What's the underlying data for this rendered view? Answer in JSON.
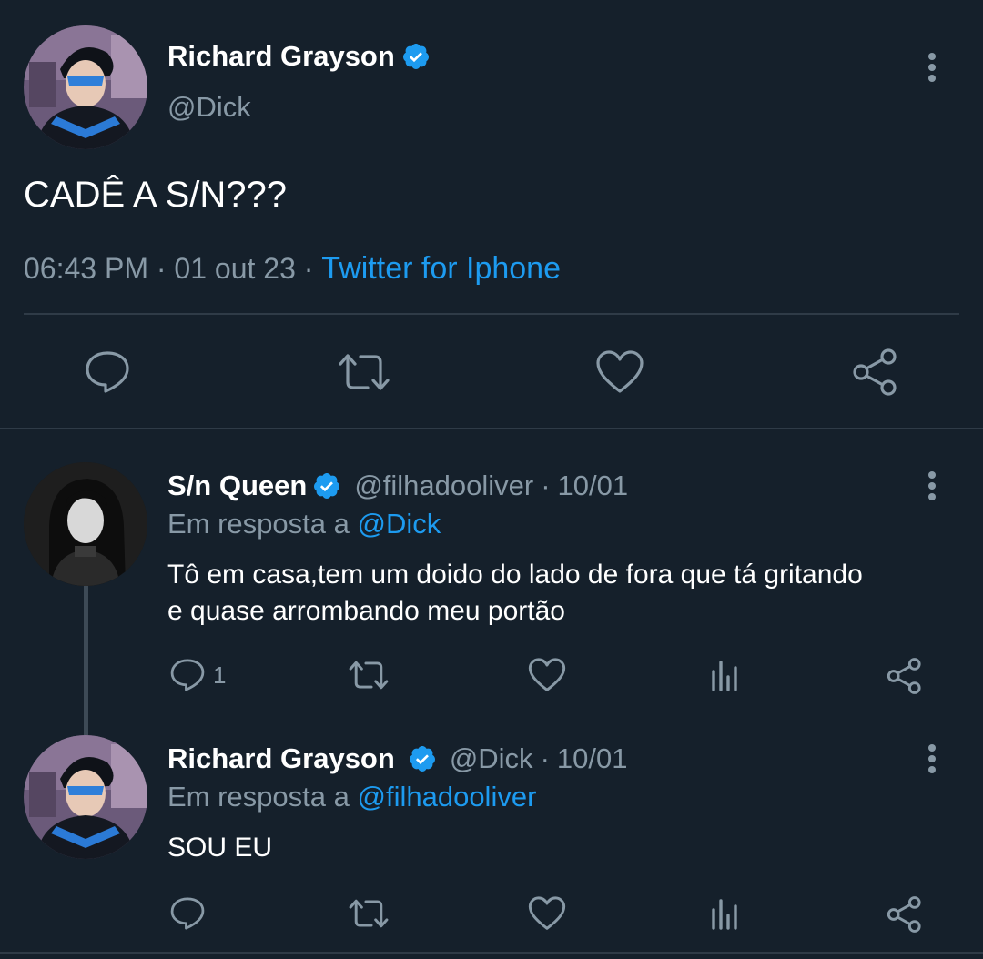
{
  "colors": {
    "background": "#15202b",
    "accent": "#1d9bf0",
    "muted": "#8899a6",
    "divider": "#2f3b47"
  },
  "main_tweet": {
    "author_name": "Richard Grayson",
    "author_handle": "@Dick",
    "text": "CADÊ A S/N???",
    "time": "06:43 PM",
    "sep1": "·",
    "date": "01 out 23",
    "sep2": "·",
    "source": "Twitter for Iphone",
    "actions": [
      "reply-icon",
      "retweet-icon",
      "like-icon",
      "share-icon"
    ]
  },
  "replies": [
    {
      "author_name": "S/n Queen",
      "author_handle": "@filhadooliver",
      "sep": "·",
      "date": "10/01",
      "reply_prefix": "Em resposta a",
      "reply_to": "@Dick",
      "text_line1": "Tô em casa,tem um doido do lado de fora que tá gritando",
      "text_line2": "e quase arrombando meu portão",
      "reply_count": "1"
    },
    {
      "author_name": "Richard Grayson",
      "author_handle": "@Dick",
      "sep": "·",
      "date": "10/01",
      "reply_prefix": "Em resposta a",
      "reply_to": "@filhadooliver",
      "text": "SOU EU"
    }
  ]
}
